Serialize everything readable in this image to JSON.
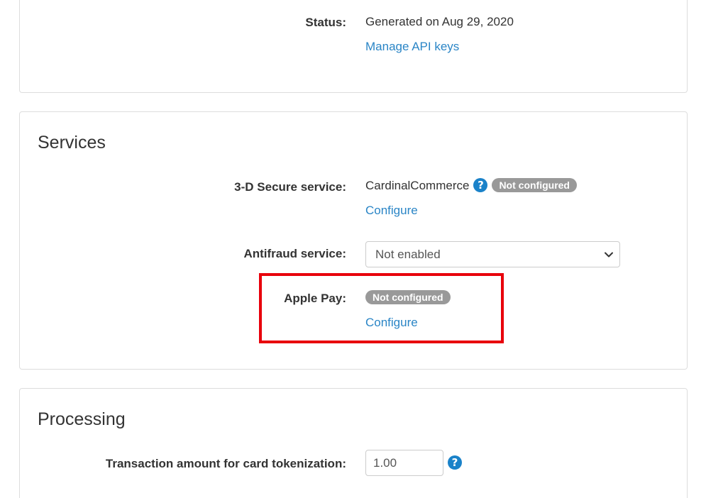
{
  "top": {
    "status_label": "Status:",
    "status_value": "Generated on Aug 29, 2020",
    "manage_link": "Manage API keys"
  },
  "services": {
    "title": "Services",
    "secure": {
      "label": "3-D Secure service:",
      "provider": "CardinalCommerce",
      "badge": "Not configured",
      "configure_link": "Configure"
    },
    "antifraud": {
      "label": "Antifraud service:",
      "selected": "Not enabled"
    },
    "apple_pay": {
      "label": "Apple Pay:",
      "badge": "Not configured",
      "configure_link": "Configure"
    }
  },
  "processing": {
    "title": "Processing",
    "tokenization": {
      "label": "Transaction amount for card tokenization:",
      "value": "1.00"
    }
  },
  "colors": {
    "link": "#2a85c6",
    "badge": "#999999",
    "help_icon": "#1a82c9",
    "highlight": "#e8000b"
  },
  "icons": {
    "help": "question-circle-icon",
    "dropdown": "chevron-down-icon"
  }
}
